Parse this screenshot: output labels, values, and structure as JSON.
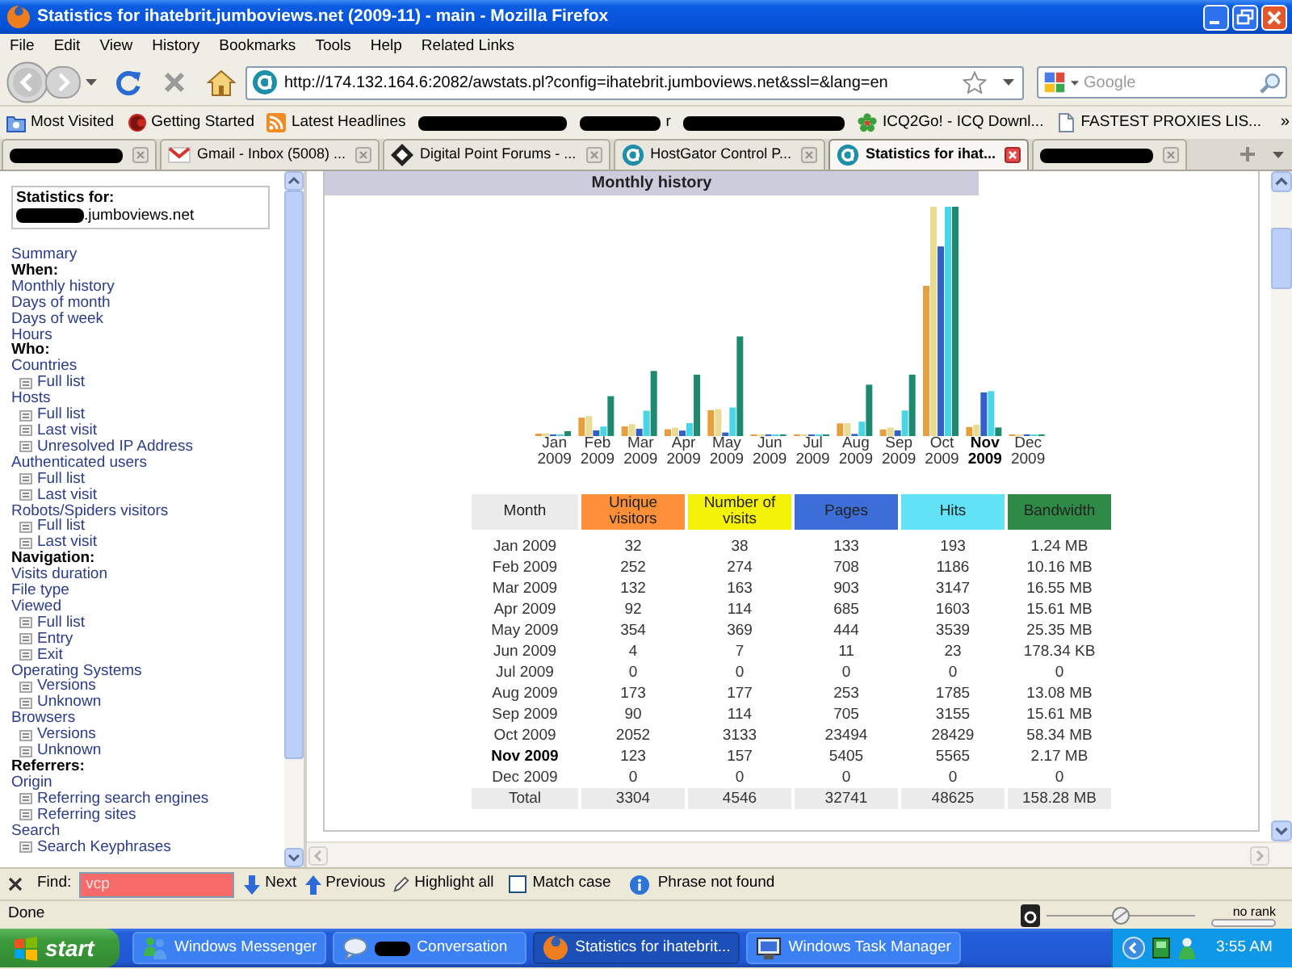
{
  "window": {
    "title": "Statistics for ihatebrit.jumboviews.net (2009-11) - main - Mozilla Firefox"
  },
  "menu": [
    "File",
    "Edit",
    "View",
    "History",
    "Bookmarks",
    "Tools",
    "Help",
    "Related Links"
  ],
  "toolbar": {
    "url": "http://174.132.164.6:2082/awstats.pl?config=ihatebrit.jumboviews.net&ssl=&lang=en",
    "search": {
      "placeholder": "Google"
    }
  },
  "bookmarks": {
    "items": [
      {
        "kind": "smart",
        "label": "Most Visited"
      },
      {
        "kind": "firefox",
        "label": "Getting Started"
      },
      {
        "kind": "feed",
        "label": "Latest Headlines"
      },
      {
        "kind": "redacted"
      },
      {
        "kind": "redacted",
        "label": "r"
      },
      {
        "kind": "redacted"
      },
      {
        "kind": "icq",
        "label": "ICQ2Go! - ICQ Downl..."
      },
      {
        "kind": "page",
        "label": "FASTEST PROXIES LIS..."
      }
    ],
    "more": "»"
  },
  "tabs": [
    {
      "kind": "redacted",
      "selected": false
    },
    {
      "kind": "mail",
      "label": "Gmail - Inbox (5008) ...",
      "selected": false
    },
    {
      "kind": "forum",
      "label": "Digital Point Forums - ...",
      "selected": false
    },
    {
      "kind": "cpanel",
      "label": "HostGator Control P...",
      "selected": false
    },
    {
      "kind": "cpanel",
      "label": "Statistics for ihat...",
      "selected": true
    },
    {
      "kind": "redacted",
      "selected": false
    }
  ],
  "sidebar": {
    "stats_label": "Statistics for:",
    "domain": ".jumboviews.net",
    "menu": [
      {
        "kind": "link",
        "label": "Summary"
      },
      {
        "kind": "heading",
        "label": "When:"
      },
      {
        "kind": "link",
        "label": "Monthly history"
      },
      {
        "kind": "link",
        "label": "Days of month"
      },
      {
        "kind": "link",
        "label": "Days of week"
      },
      {
        "kind": "link",
        "label": "Hours"
      },
      {
        "kind": "heading",
        "label": "Who:"
      },
      {
        "kind": "link",
        "label": "Countries",
        "children": [
          {
            "label": "Full list"
          }
        ]
      },
      {
        "kind": "link",
        "label": "Hosts",
        "children": [
          {
            "label": "Full list"
          },
          {
            "label": "Last visit"
          },
          {
            "label": "Unresolved IP Address"
          }
        ]
      },
      {
        "kind": "link",
        "label": "Authenticated users",
        "children": [
          {
            "label": "Full list"
          },
          {
            "label": "Last visit"
          }
        ]
      },
      {
        "kind": "link",
        "label": "Robots/Spiders visitors",
        "children": [
          {
            "label": "Full list"
          },
          {
            "label": "Last visit"
          }
        ]
      },
      {
        "kind": "heading",
        "label": "Navigation:"
      },
      {
        "kind": "link",
        "label": "Visits duration"
      },
      {
        "kind": "link",
        "label": "File type"
      },
      {
        "kind": "link",
        "label": "Viewed",
        "children": [
          {
            "label": "Full list"
          },
          {
            "label": "Entry"
          },
          {
            "label": "Exit"
          }
        ]
      },
      {
        "kind": "link",
        "label": "Operating Systems",
        "children": [
          {
            "label": "Versions"
          },
          {
            "label": "Unknown"
          }
        ]
      },
      {
        "kind": "link",
        "label": "Browsers",
        "children": [
          {
            "label": "Versions"
          },
          {
            "label": "Unknown"
          }
        ]
      },
      {
        "kind": "heading",
        "label": "Referrers:"
      },
      {
        "kind": "link",
        "label": "Origin",
        "children": [
          {
            "label": "Referring search engines"
          },
          {
            "label": "Referring sites"
          }
        ]
      },
      {
        "kind": "link",
        "label": "Search",
        "children": [
          {
            "label": "Search Keyphrases"
          }
        ]
      }
    ]
  },
  "monthly_history": {
    "title": "Monthly history",
    "x_labels": [
      {
        "text": "Jan 2009",
        "current": false
      },
      {
        "text": "Feb 2009",
        "current": false
      },
      {
        "text": "Mar 2009",
        "current": false
      },
      {
        "text": "Apr 2009",
        "current": false
      },
      {
        "text": "May 2009",
        "current": false
      },
      {
        "text": "Jun 2009",
        "current": false
      },
      {
        "text": "Jul 2009",
        "current": false
      },
      {
        "text": "Aug 2009",
        "current": false
      },
      {
        "text": "Sep 2009",
        "current": false
      },
      {
        "text": "Oct 2009",
        "current": false
      },
      {
        "text": "Nov 2009",
        "current": true
      },
      {
        "text": "Dec 2009",
        "current": false
      }
    ],
    "table": {
      "columns": [
        {
          "label": "Month",
          "color": "#ececec"
        },
        {
          "label": "Unique visitors",
          "color": "#fb9038"
        },
        {
          "label": "Number of visits",
          "color": "#f5f20a"
        },
        {
          "label": "Pages",
          "color": "#3d6dd6"
        },
        {
          "label": "Hits",
          "color": "#62e2f5"
        },
        {
          "label": "Bandwidth",
          "color": "#2e8a46"
        }
      ],
      "rows": [
        {
          "current": false,
          "cells": [
            "Jan 2009",
            "32",
            "38",
            "133",
            "193",
            "1.24 MB"
          ]
        },
        {
          "current": false,
          "cells": [
            "Feb 2009",
            "252",
            "274",
            "708",
            "1186",
            "10.16 MB"
          ]
        },
        {
          "current": false,
          "cells": [
            "Mar 2009",
            "132",
            "163",
            "903",
            "3147",
            "16.55 MB"
          ]
        },
        {
          "current": false,
          "cells": [
            "Apr 2009",
            "92",
            "114",
            "685",
            "1603",
            "15.61 MB"
          ]
        },
        {
          "current": false,
          "cells": [
            "May 2009",
            "354",
            "369",
            "444",
            "3539",
            "25.35 MB"
          ]
        },
        {
          "current": false,
          "cells": [
            "Jun 2009",
            "4",
            "7",
            "11",
            "23",
            "178.34 KB"
          ]
        },
        {
          "current": false,
          "cells": [
            "Jul 2009",
            "0",
            "0",
            "0",
            "0",
            "0"
          ]
        },
        {
          "current": false,
          "cells": [
            "Aug 2009",
            "173",
            "177",
            "253",
            "1785",
            "13.08 MB"
          ]
        },
        {
          "current": false,
          "cells": [
            "Sep 2009",
            "90",
            "114",
            "705",
            "3155",
            "15.61 MB"
          ]
        },
        {
          "current": false,
          "cells": [
            "Oct 2009",
            "2052",
            "3133",
            "23494",
            "28429",
            "58.34 MB"
          ]
        },
        {
          "current": true,
          "cells": [
            "Nov 2009",
            "123",
            "157",
            "5405",
            "5565",
            "2.17 MB"
          ]
        },
        {
          "current": false,
          "cells": [
            "Dec 2009",
            "0",
            "0",
            "0",
            "0",
            "0"
          ]
        }
      ],
      "total": {
        "cells": [
          "Total",
          "3304",
          "4546",
          "32741",
          "48625",
          "158.28 MB"
        ]
      }
    }
  },
  "find_bar": {
    "label": "Find:",
    "value": "vcp",
    "not_found": true,
    "next": "Next",
    "previous": "Previous",
    "highlight": "Highlight all",
    "match_case": {
      "label": "Match case",
      "checked": false
    },
    "message": "Phrase not found"
  },
  "status_bar": {
    "text": "Done",
    "rank": "no rank"
  },
  "taskbar": {
    "start": "start",
    "buttons": [
      {
        "kind": "messenger",
        "label": "Windows Messenger",
        "selected": false
      },
      {
        "kind": "chat",
        "label": "Conversation",
        "selected": false
      },
      {
        "kind": "firefox",
        "label": "Statistics for ihatebrit...",
        "selected": true
      },
      {
        "kind": "taskmanager",
        "label": "Windows Task Manager",
        "selected": false
      }
    ],
    "clock": "3:55 AM"
  }
}
